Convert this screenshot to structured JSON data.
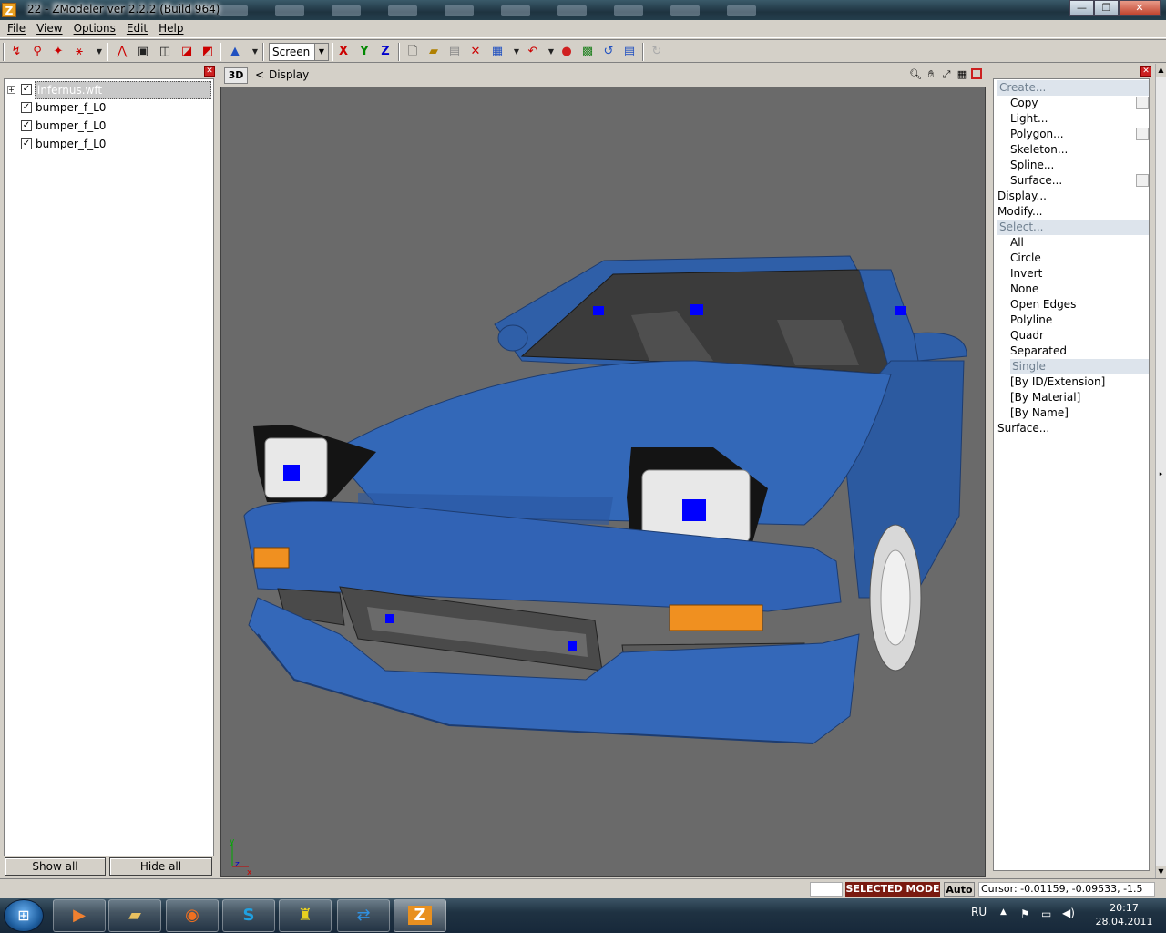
{
  "window": {
    "title": "22 - ZModeler ver 2.2.2 (Build 964)",
    "app_icon": "Z",
    "minimize": "—",
    "maximize": "❐",
    "close": "✕"
  },
  "menu": [
    "File",
    "View",
    "Options",
    "Edit",
    "Help"
  ],
  "toolbar": {
    "coord_mode": "Screen",
    "axis_x": "X",
    "axis_y": "Y",
    "axis_z": "Z"
  },
  "object_tree": {
    "items": [
      {
        "label": "infernus.wft",
        "checked": true,
        "selected": true
      },
      {
        "label": "bumper_f_L0",
        "checked": true
      },
      {
        "label": "bumper_f_L0",
        "checked": true
      },
      {
        "label": "bumper_f_L0",
        "checked": true
      }
    ],
    "show_all": "Show all",
    "hide_all": "Hide all"
  },
  "viewport": {
    "mode": "3D",
    "back": "<",
    "label": "Display",
    "body_color": "#2f5fa8",
    "background_color": "#6a6a6a"
  },
  "command_panel": {
    "create": "Create...",
    "create_items": [
      "Copy",
      "Light...",
      "Polygon...",
      "Skeleton...",
      "Spline...",
      "Surface..."
    ],
    "display": "Display...",
    "modify": "Modify...",
    "select": "Select...",
    "select_items": [
      "All",
      "Circle",
      "Invert",
      "None",
      "Open Edges",
      "Polyline",
      "Quadr",
      "Separated",
      "Single",
      "[By ID/Extension]",
      "[By Material]",
      "[By Name]"
    ],
    "surface": "Surface..."
  },
  "status": {
    "mode": "SELECTED MODE",
    "auto": "Auto",
    "cursor": "Cursor: -0.01159, -0.09533, -1.5"
  },
  "taskbar": {
    "language": "RU",
    "time": "20:17",
    "date": "28.04.2011",
    "apps": [
      "media-player",
      "file-explorer",
      "firefox",
      "skype",
      "game-app",
      "teamviewer",
      "zmodeler"
    ]
  }
}
